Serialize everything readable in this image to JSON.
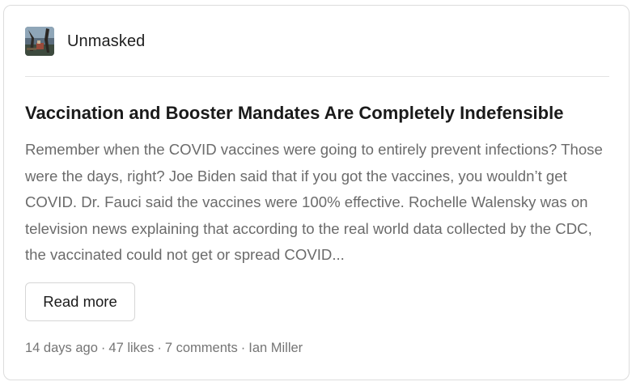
{
  "publication": {
    "name": "Unmasked",
    "avatar_icon": "publication-logo"
  },
  "post": {
    "title": "Vaccination and Booster Mandates Are Completely Indefensible",
    "excerpt": "Remember when the COVID vaccines were going to entirely prevent infections? Those were the days, right? Joe Biden said that if you got the vaccines, you wouldn’t get COVID. Dr. Fauci said the vaccines were 100% effective. Rochelle Walensky was on television news explaining that according to the real world data collected by the CDC, the vaccinated could not get or spread COVID...",
    "read_more_label": "Read more"
  },
  "meta": {
    "age": "14 days ago",
    "likes": "47 likes",
    "comments": "7 comments",
    "author": "Ian Miller",
    "separator": "·"
  }
}
